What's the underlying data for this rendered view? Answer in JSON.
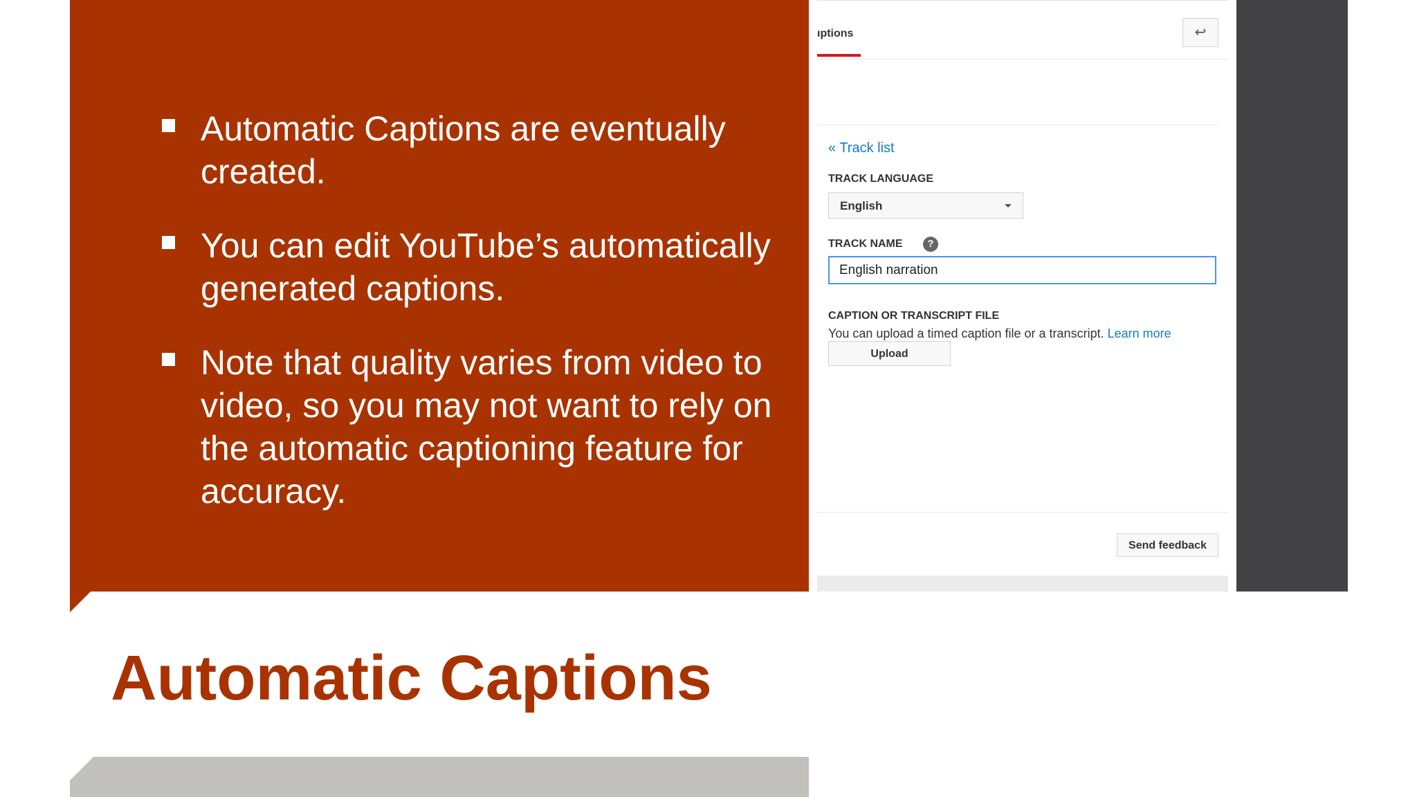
{
  "slide": {
    "title": "Automatic Captions",
    "bullets": [
      "Automatic Captions are eventually created.",
      "You can edit YouTube’s automatically generated captions.",
      "Note that quality varies from video to video, so you may not want to rely on the automatic captioning feature for accuracy."
    ]
  },
  "colors": {
    "accent": "#a83300",
    "panel_dark": "#434345",
    "bar_gray": "#c1c0bb",
    "link_blue": "#167ac6",
    "focus_blue": "#4d90fe",
    "tab_red": "#cc181e"
  },
  "screenshot": {
    "tab_label": "ıptions",
    "back_icon": "back-arrow-icon",
    "back_glyph": "↩",
    "track_list_link": "« Track list",
    "track_language_label": "TRACK LANGUAGE",
    "track_language_value": "English",
    "track_name_label": "TRACK NAME",
    "help_icon": "question-mark-icon",
    "help_glyph": "?",
    "track_name_value": "English narration",
    "caption_file_label": "CAPTION OR TRANSCRIPT FILE",
    "caption_file_help": "You can upload a timed caption file or a transcript.",
    "learn_more": "Learn more",
    "upload_button": "Upload",
    "send_feedback_button": "Send feedback"
  }
}
